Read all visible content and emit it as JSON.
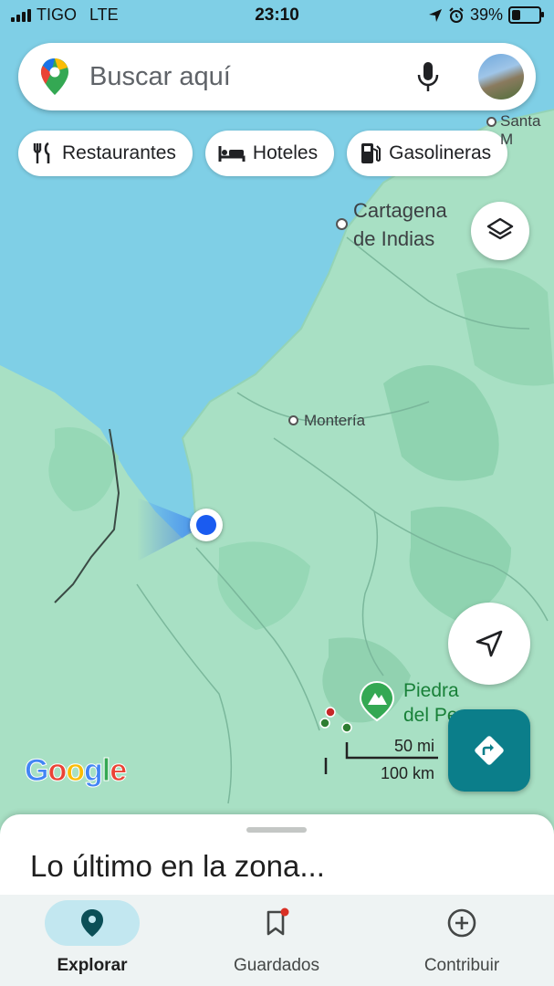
{
  "status_bar": {
    "carrier": "TIGO",
    "network": "LTE",
    "time": "23:10",
    "battery": "39%",
    "battery_level": 0.39
  },
  "search": {
    "placeholder": "Buscar aquí"
  },
  "chips": [
    {
      "label": "Restaurantes",
      "icon": "fork-knife-icon"
    },
    {
      "label": "Hoteles",
      "icon": "bed-icon"
    },
    {
      "label": "Gasolineras",
      "icon": "gas-pump-icon"
    }
  ],
  "map": {
    "places": {
      "santa_marta": "Santa M",
      "cartagena": "Cartagena de Indias",
      "monteria": "Montería",
      "piedra": "Piedra del Pe"
    },
    "scale": {
      "miles": "50 mi",
      "km": "100 km"
    },
    "attribution": "Google"
  },
  "sheet": {
    "title": "Lo último en la zona..."
  },
  "nav": {
    "explore": "Explorar",
    "saved": "Guardados",
    "contribute": "Contribuir"
  },
  "colors": {
    "water": "#7fcfe6",
    "land": "#a8e0c4",
    "accent": "#0b7e8a",
    "location_dot": "#1a5bf0"
  }
}
